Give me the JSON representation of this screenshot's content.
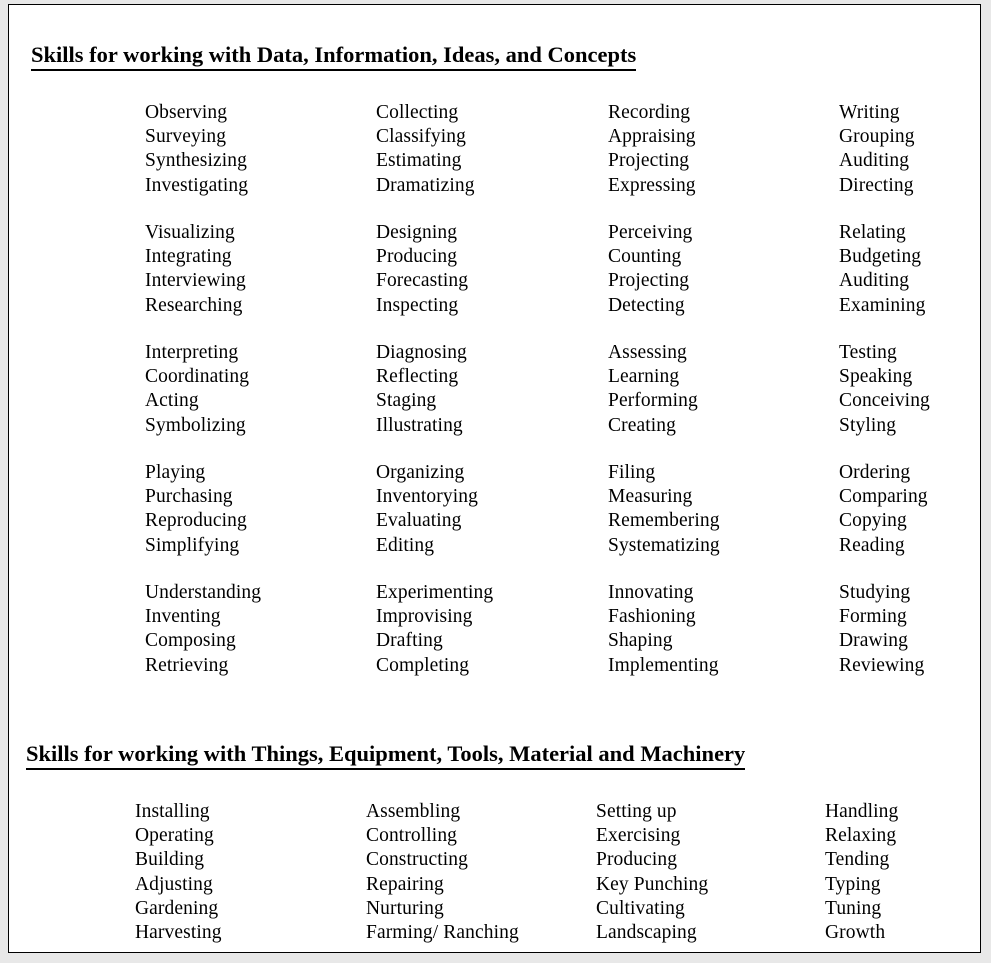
{
  "document": {
    "background_color": "#e8e8e8",
    "page_color": "#ffffff",
    "text_color": "#000000",
    "border_color": "#000000"
  },
  "sections": [
    {
      "id": "data-information-ideas-concepts",
      "heading": "Skills for working with Data, Information, Ideas, and Concepts",
      "groups": [
        {
          "columns": [
            [
              "Observing",
              "Surveying",
              "Synthesizing",
              "Investigating"
            ],
            [
              "Collecting",
              "Classifying",
              "Estimating",
              "Dramatizing"
            ],
            [
              "Recording",
              "Appraising",
              "Projecting",
              "Expressing"
            ],
            [
              "Writing",
              "Grouping",
              "Auditing",
              "Directing"
            ]
          ]
        },
        {
          "columns": [
            [
              "Visualizing",
              "Integrating",
              "Interviewing",
              "Researching"
            ],
            [
              "Designing",
              "Producing",
              "Forecasting",
              "Inspecting"
            ],
            [
              "Perceiving",
              "Counting",
              "Projecting",
              "Detecting"
            ],
            [
              "Relating",
              "Budgeting",
              "Auditing",
              "Examining"
            ]
          ]
        },
        {
          "columns": [
            [
              "Interpreting",
              "Coordinating",
              "Acting",
              "Symbolizing"
            ],
            [
              "Diagnosing",
              "Reflecting",
              "Staging",
              "Illustrating"
            ],
            [
              "Assessing",
              "Learning",
              "Performing",
              "Creating"
            ],
            [
              "Testing",
              "Speaking",
              "Conceiving",
              "Styling"
            ]
          ]
        },
        {
          "columns": [
            [
              "Playing",
              "Purchasing",
              "Reproducing",
              "Simplifying"
            ],
            [
              "Organizing",
              "Inventorying",
              "Evaluating",
              "Editing"
            ],
            [
              "Filing",
              "Measuring",
              "Remembering",
              "Systematizing"
            ],
            [
              "Ordering",
              "Comparing",
              "Copying",
              "Reading"
            ]
          ]
        },
        {
          "columns": [
            [
              "Understanding",
              "Inventing",
              "Composing",
              "Retrieving"
            ],
            [
              "Experimenting",
              "Improvising",
              "Drafting",
              "Completing"
            ],
            [
              "Innovating",
              "Fashioning",
              "Shaping",
              "Implementing"
            ],
            [
              "Studying",
              "Forming",
              "Drawing",
              "Reviewing"
            ]
          ]
        }
      ]
    },
    {
      "id": "things-equipment-tools-material-machinery",
      "heading": "Skills for working with Things, Equipment, Tools, Material and Machinery",
      "groups": [
        {
          "columns": [
            [
              "Installing",
              "Operating",
              "Building",
              "Adjusting",
              "Gardening",
              "Harvesting"
            ],
            [
              "Assembling",
              "Controlling",
              "Constructing",
              "Repairing",
              "Nurturing",
              "Farming/ Ranching"
            ],
            [
              "Setting up",
              "Exercising",
              "Producing",
              "Key Punching",
              "Cultivating",
              "Landscaping"
            ],
            [
              "Handling",
              "Relaxing",
              "Tending",
              "Typing",
              "Tuning",
              "Growth"
            ]
          ]
        }
      ]
    }
  ]
}
